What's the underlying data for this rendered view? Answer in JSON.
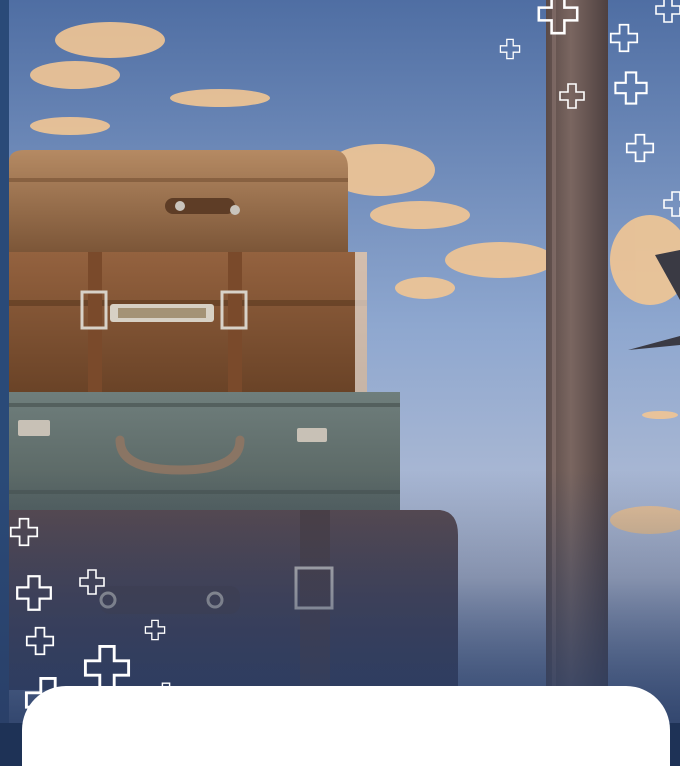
{
  "photo": {
    "subject": "stacked-vintage-suitcases-with-airplane-at-sunset",
    "colors": {
      "sky_top": "#5b78a8",
      "sky_mid": "#8ea7cf",
      "horizon": "#d6b9a3",
      "cloud": "#f2c694",
      "frame_blue": "#2a4a78",
      "pillar": "#6d5a55",
      "cross_outline": "#ffffff"
    }
  },
  "icons": [
    "plus-cross-icon"
  ]
}
